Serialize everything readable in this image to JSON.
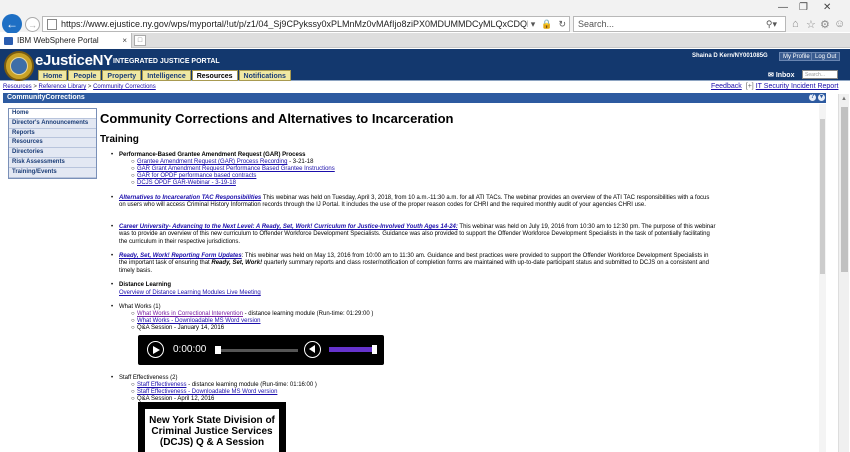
{
  "browser": {
    "url": "https://www.ejustice.ny.gov/wps/myportal/!ut/p/z1/04_Sj9CPykssy0xPLMnMz0vMAfIjo8ziPX0MDUMMDCyMLQxCDQP8vdx9DA0gQD-ck",
    "search_placeholder": "Search...",
    "tab_title": "IBM WebSphere Portal"
  },
  "header": {
    "logo": "eJusticeNY",
    "logo_sub": "INTEGRATED JUSTICE PORTAL",
    "user": "Shaina D Kern/NY001085G",
    "my_profile": "My Profile",
    "log_out": "Log Out",
    "inbox": "Inbox",
    "inbox_placeholder": "Search..."
  },
  "topnav": [
    "Home",
    "People",
    "Property",
    "Intelligence",
    "Resources",
    "Notifications"
  ],
  "breadcrumb": [
    "Resources",
    "Reference Library",
    "Community Corrections"
  ],
  "links": {
    "feedback": "Feedback",
    "security": "IT Security Incident Report"
  },
  "portlet": {
    "title": "CommunityCorrections"
  },
  "sidebar": [
    "Home",
    "Director's Announcements",
    "Reports",
    "Resources",
    "Directories",
    "Risk Assessments",
    "Training/Events"
  ],
  "content": {
    "title": "Community Corrections and Alternatives to Incarceration",
    "section": "Training",
    "gar": {
      "heading": "Performance-Based Grantee Amendment Request (GAR) Process",
      "items": [
        {
          "link": "Grantee Amendment Request (GAR) Process Recording",
          "suffix": " - 3-21-18"
        },
        {
          "link": "GAR Grant Amendment Request Performance Based Grantee Instructions",
          "suffix": ""
        },
        {
          "link": "GAR for OPDF performance based contracts",
          "suffix": ""
        },
        {
          "link": "DCJS OPDF GAR-Webinar - 3-19-18",
          "suffix": ""
        }
      ]
    },
    "tac": {
      "link": "Alternatives to Incarceration TAC Responsibilities",
      "text": " This webinar was held on Tuesday, April 3, 2018, from 10 a.m.-11:30 a.m. for all ATI TACs. The webinar provides an overview of the ATI TAC responsibilities with a focus on users who will access Criminal History Information records through the IJ Portal. It includes the use of the proper reason codes for CHRI and the required monthly audit of your agencies CHRI use."
    },
    "career": {
      "link": "Career University- Advancing to the Next Level: A Ready, Set, Work! Curriculum for Justice-Involved Youth Ages 14-24:",
      "text": " This webinar was held on July 19, 2016 from 10:30 am to 12:30 pm.   The purpose of this webinar was to provide an overview of this new curriculum to Offender Workforce Development Specialists.  Guidance was also provided to support the Offender Workforce Development Specialists in the task of potentially facilitating the curriculum in their respective jurisdictions."
    },
    "rsw": {
      "link": "Ready, Set, Work! Reporting Form Updates",
      "text1": ": This webinar was held on May 13, 2016 from 10:00 am to 11:30 am. Guidance and best practices were provided to support the Offender Workforce Development Specialists in the important task of ensuring that ",
      "em": "Ready, Set, Work!",
      "text2": " quarterly summary reports and class roster/notification of completion forms are maintained with up-to-date participant status and submitted to DCJS on a consistent and timely basis."
    },
    "dl": {
      "heading": "Distance Learning",
      "link": "Overview of Distance Learning Modules Live Meeting"
    },
    "ww": {
      "heading": "What Works (1)",
      "link1": "What Works in Correctional Intervention",
      "text1": " - distance learning module (Run-time: 01:29:00 )",
      "link2": "What Works - Downloadable MS Word version",
      "qa": "Q&A Session - January 14, 2016"
    },
    "audio": {
      "time": "0:00:00",
      "volume_level": 0.85
    },
    "se": {
      "heading": "Staff Effectiveness (2)",
      "link1": "Staff Effectiveness",
      "text1": " - distance learning module (Run-time: 01:16:00 )",
      "link2": "Staff Effectiveness - Downloadable MS Word version",
      "qa": "Q&A Session - April 12, 2016"
    },
    "video_text": "New York State Division of Criminal Justice Services (DCJS) Q & A Session"
  }
}
